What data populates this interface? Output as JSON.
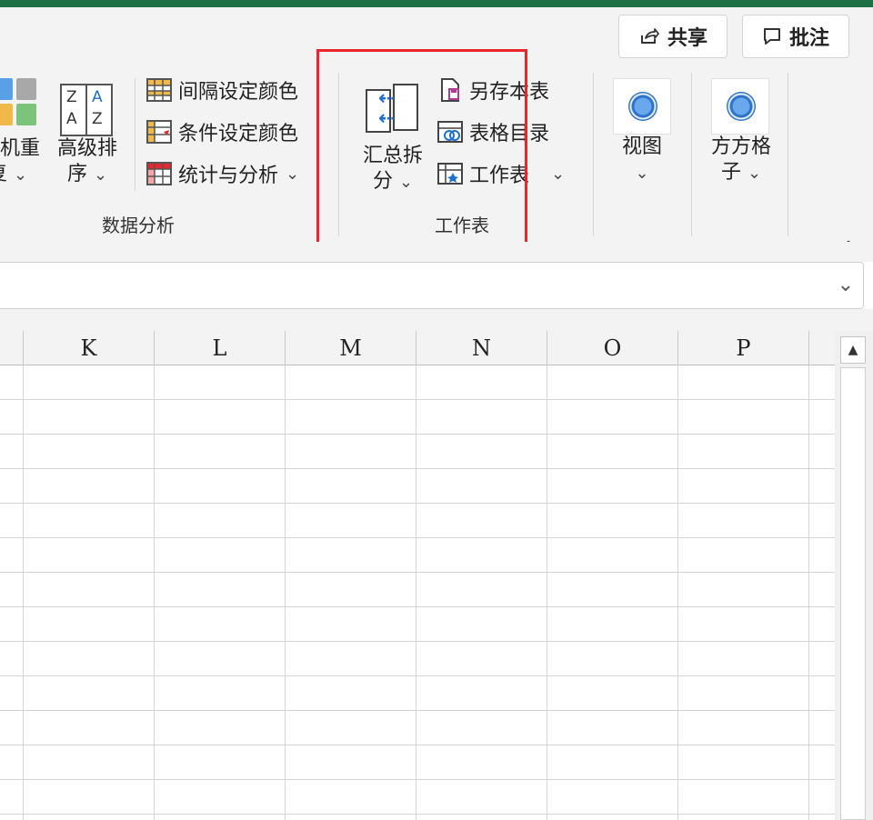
{
  "header": {
    "share_label": "共享",
    "comment_label": "批注"
  },
  "ribbon": {
    "data_analysis": {
      "random_label_1": "机重",
      "random_label_2": "复",
      "sort_label_1": "高级排",
      "sort_label_2": "序",
      "sort_icon_letters": [
        "Z",
        "A",
        "A",
        "Z"
      ],
      "interval_color": "间隔设定颜色",
      "condition_color": "条件设定颜色",
      "stats_analysis": "统计与分析",
      "group_label": "数据分析"
    },
    "worksheet": {
      "summary_split_1": "汇总拆",
      "summary_split_2": "分",
      "save_sheet": "另存本表",
      "table_catalog": "表格目录",
      "worksheet_menu": "工作表",
      "group_label": "工作表"
    },
    "view_label": "视图",
    "fangfang_label_1": "方方格",
    "fangfang_label_2": "子"
  },
  "grid": {
    "columns": [
      "K",
      "L",
      "M",
      "N",
      "O",
      "P"
    ]
  },
  "colors": {
    "brand_green": "#1e7145",
    "highlight_red": "#e8262b",
    "accent_blue": "#2d72c8"
  }
}
